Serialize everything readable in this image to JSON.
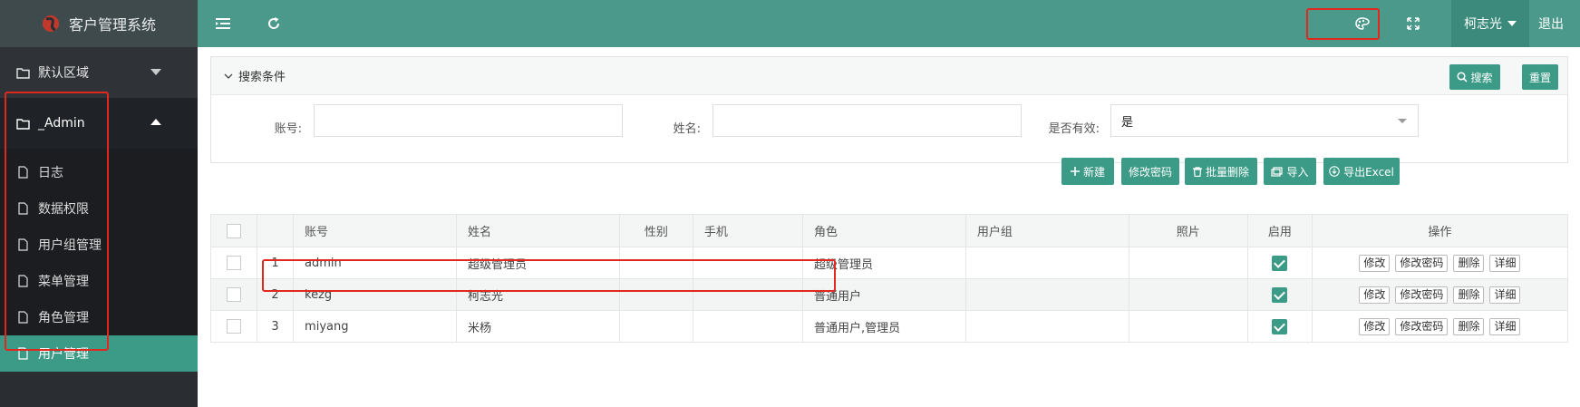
{
  "app": {
    "title": "客户管理系统"
  },
  "sidebar": {
    "groups": [
      {
        "label": "默认区域"
      },
      {
        "label": "_Admin"
      }
    ],
    "items": [
      {
        "label": "日志"
      },
      {
        "label": "数据权限"
      },
      {
        "label": "用户组管理"
      },
      {
        "label": "菜单管理"
      },
      {
        "label": "角色管理"
      },
      {
        "label": "用户管理"
      }
    ],
    "active_item": "用户管理"
  },
  "topbar": {
    "user_name": "柯志光",
    "logout_label": "退出"
  },
  "search": {
    "title": "搜索条件",
    "search_button": "搜索",
    "reset_button": "重置",
    "fields": {
      "account_label": "账号:",
      "name_label": "姓名:",
      "valid_label": "是否有效:",
      "valid_value": "是"
    }
  },
  "toolbar": {
    "new": "新建",
    "change_password": "修改密码",
    "batch_delete": "批量删除",
    "import": "导入",
    "export": "导出Excel"
  },
  "table": {
    "columns": [
      "账号",
      "姓名",
      "性别",
      "手机",
      "角色",
      "用户组",
      "照片",
      "启用",
      "操作"
    ],
    "rows": [
      {
        "index": "1",
        "account": "admin",
        "name": "超级管理员",
        "gender": "",
        "phone": "",
        "role": "超级管理员",
        "group": "",
        "photo": "",
        "enabled": true
      },
      {
        "index": "2",
        "account": "kezg",
        "name": "柯志光",
        "gender": "",
        "phone": "",
        "role": "普通用户",
        "group": "",
        "photo": "",
        "enabled": true
      },
      {
        "index": "3",
        "account": "miyang",
        "name": "米杨",
        "gender": "",
        "phone": "",
        "role": "普通用户,管理员",
        "group": "",
        "photo": "",
        "enabled": true
      }
    ],
    "row_actions": {
      "edit": "修改",
      "change_password": "修改密码",
      "delete": "删除",
      "detail": "详细"
    }
  },
  "colors": {
    "accent": "#3c9b86",
    "topbar": "#4a998a",
    "sidebar": "#2a2e33",
    "annotation": "#e0281f"
  }
}
